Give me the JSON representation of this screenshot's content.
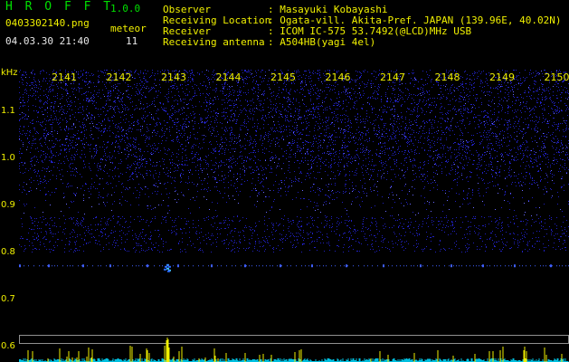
{
  "header": {
    "app_title": "H R O F F T",
    "version": "1.0.0",
    "filename": "0403302140.png",
    "datetime": "04.03.30 21:40",
    "meteor_label": "meteor",
    "meteor_count": "11",
    "observer_label": "Observer",
    "observer_value": ": Masayuki Kobayashi",
    "location_label": "Receiving Location",
    "location_value": ": Ogata-vill. Akita-Pref. JAPAN (139.96E, 40.02N)",
    "receiver_label": "Receiver",
    "receiver_value": ": ICOM IC-575 53.7492(@LCD)MHz USB",
    "antenna_label": "Receiving antenna",
    "antenna_value": ": A504HB(yagi 4el)"
  },
  "chart_data": {
    "type": "heatmap",
    "ylabel": "kHz",
    "x_ticks": [
      "2141",
      "2142",
      "2143",
      "2144",
      "2145",
      "2146",
      "2147",
      "2148",
      "2149",
      "2150"
    ],
    "y_ticks": [
      "1.1",
      "1.0",
      "0.9",
      "0.8",
      "0.7",
      "0.6"
    ],
    "y_tick_values": [
      1.1,
      1.0,
      0.9,
      0.8,
      0.7,
      0.6
    ],
    "ylim": [
      0.57,
      1.19
    ],
    "noise_band_kHz": [
      0.88,
      1.19
    ],
    "carrier_line_kHz": 0.775,
    "meteor_echo": {
      "x_minute": 2142.9,
      "freq_kHz": 0.77
    },
    "colors": {
      "noise": "#2020c0",
      "carrier": "#4060ff",
      "echo": "#40c0ff",
      "bottom_trace": "#f0f000",
      "bottom_base": "#00c0e0"
    }
  }
}
